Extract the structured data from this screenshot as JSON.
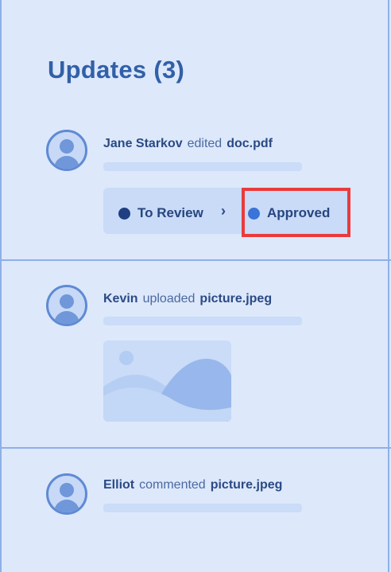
{
  "header": {
    "title": "Updates (3)"
  },
  "updates": [
    {
      "user": "Jane Starkov",
      "action": "edited",
      "file": "doc.pdf",
      "status": {
        "from": "To Review",
        "to": "Approved"
      }
    },
    {
      "user": "Kevin",
      "action": "uploaded",
      "file": "picture.jpeg",
      "thumbnail_icon": "image-icon"
    },
    {
      "user": "Elliot",
      "action": "commented",
      "file": "picture.jpeg"
    }
  ],
  "colors": {
    "background": "#dde8fb",
    "accent": "#3160a7",
    "status_from_dot": "#1f3f82",
    "status_to_dot": "#3b73d8",
    "highlight": "#ea3b3b"
  }
}
